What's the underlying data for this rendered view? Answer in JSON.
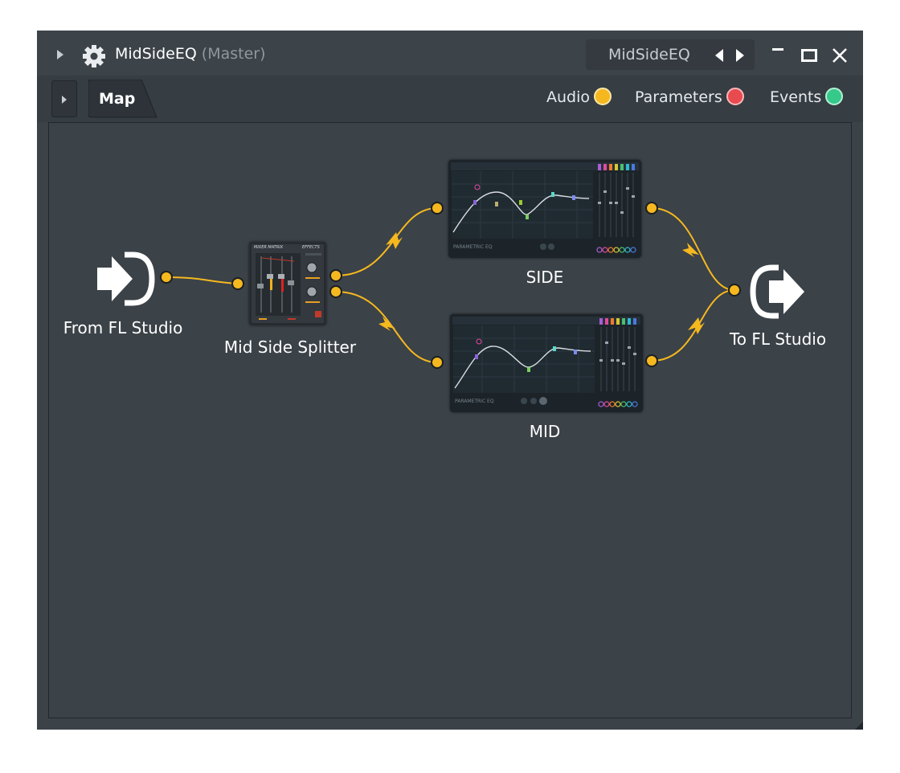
{
  "window": {
    "title": "MidSideEQ",
    "subtitle": "(Master)",
    "preset_name": "MidSideEQ",
    "minimize_label": "−",
    "maximize_label": "□",
    "close_label": "✕"
  },
  "tabs": [
    {
      "label": "Map",
      "active": true
    }
  ],
  "legend": [
    {
      "label": "Audio",
      "color": "#f5b81e"
    },
    {
      "label": "Parameters",
      "color": "#e84a4f"
    },
    {
      "label": "Events",
      "color": "#35c98a"
    }
  ],
  "nodes": {
    "from": {
      "label": "From FL Studio",
      "icon": "audio-input-icon"
    },
    "splitter": {
      "label": "Mid Side Splitter",
      "icon": "mixer-matrix-plugin-thumbnail"
    },
    "side": {
      "label": "SIDE",
      "icon": "parametric-eq-plugin-thumbnail"
    },
    "mid": {
      "label": "MID",
      "icon": "parametric-eq-plugin-thumbnail"
    },
    "to": {
      "label": "To FL Studio",
      "icon": "audio-output-icon"
    }
  },
  "plugin_text": {
    "mixer_matrix": "MIXER MATRIX",
    "effects": "EFFECTS",
    "eq_brand": "PARAMETRIC EQ"
  },
  "colors": {
    "audio_wire": "#f5b81e",
    "window_bg": "#3b4248",
    "titlebar_bg": "#3c4349"
  }
}
